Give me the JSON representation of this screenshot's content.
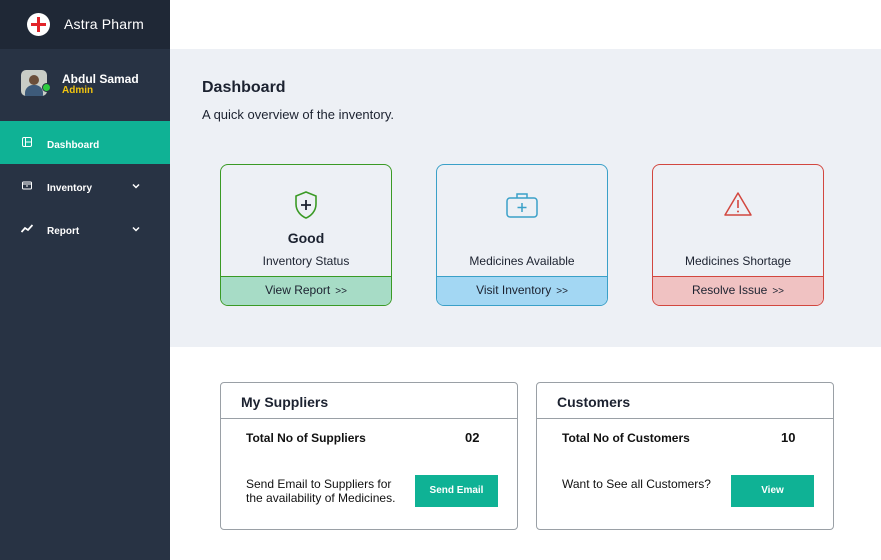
{
  "app": {
    "name": "Astra Pharm",
    "logo_icon": "red-cross-icon"
  },
  "user": {
    "name": "Abdul Samad",
    "role": "Admin",
    "status": "online"
  },
  "sidebar": {
    "items": [
      {
        "label": "Dashboard",
        "icon": "dashboard-icon",
        "active": true
      },
      {
        "label": "Inventory",
        "icon": "inventory-icon",
        "has_submenu": true
      },
      {
        "label": "Report",
        "icon": "chart-line-icon",
        "has_submenu": true
      }
    ]
  },
  "main": {
    "title": "Dashboard",
    "subtitle": "A quick overview of the inventory."
  },
  "cards": [
    {
      "value": "Good",
      "label": "Inventory Status",
      "action": "View Report",
      "arrow": ">>",
      "icon": "shield-plus-icon",
      "color": "#3a9a25"
    },
    {
      "label": "Medicines Available",
      "action": "Visit Inventory",
      "arrow": ">>",
      "icon": "medical-kit-icon",
      "color": "#3aa0c8"
    },
    {
      "label": "Medicines Shortage",
      "action": "Resolve Issue",
      "arrow": ">>",
      "icon": "warning-icon",
      "color": "#d2473f"
    }
  ],
  "suppliers": {
    "title": "My Suppliers",
    "total_label": "Total No of Suppliers",
    "total_value": "02",
    "text_line1": "Send Email to Suppliers for",
    "text_line2": "the availability of Medicines.",
    "button": "Send Email"
  },
  "customers": {
    "title": "Customers",
    "total_label": "Total No of Customers",
    "total_value": "10",
    "text": "Want to See all Customers?",
    "button": "View"
  },
  "colors": {
    "sidebar_bg": "#283344",
    "accent": "#0fb295",
    "hero_bg": "#edf0f5"
  }
}
